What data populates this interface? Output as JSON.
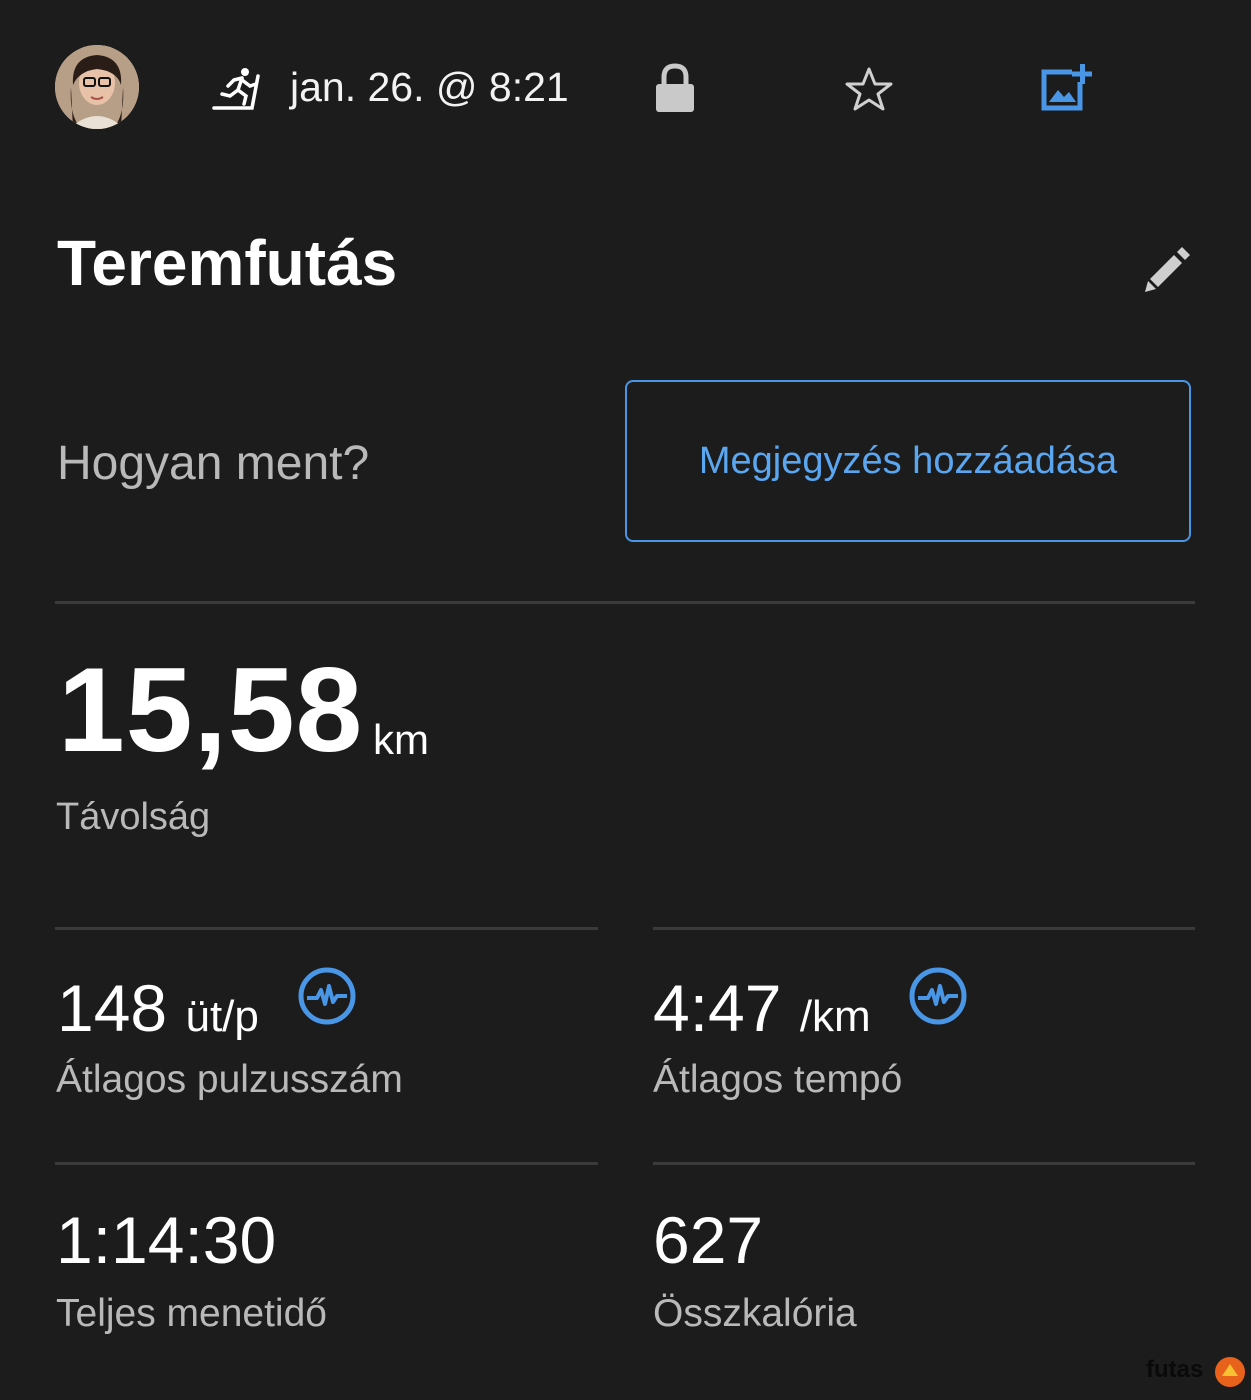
{
  "header": {
    "activity_icon": "treadmill-run-icon",
    "date_time": "jan. 26. @ 8:21",
    "privacy_icon": "lock-icon",
    "favorite_icon": "star-outline-icon",
    "add_photo_icon": "add-photo-icon"
  },
  "activity": {
    "title": "Teremfutás",
    "edit_icon": "pencil-icon"
  },
  "feeling": {
    "prompt": "Hogyan ment?",
    "add_note_label": "Megjegyzés hozzáadása"
  },
  "distance": {
    "value": "15,58",
    "unit": "km",
    "label": "Távolság"
  },
  "stats": [
    {
      "value": "148",
      "unit": "üt/p",
      "label": "Átlagos pulzusszám",
      "icon": "heart-rate-icon"
    },
    {
      "value": "4:47",
      "unit": "/km",
      "label": "Átlagos tempó",
      "icon": "heart-rate-icon"
    },
    {
      "value": "1:14:30",
      "unit": "",
      "label": "Teljes menetidő"
    },
    {
      "value": "627",
      "unit": "",
      "label": "Összkalória"
    }
  ],
  "watermark": "futas",
  "colors": {
    "background": "#1c1c1d",
    "accent": "#4a96e6",
    "secondary_text": "#b9b9b9",
    "divider": "#3a3a3b"
  }
}
